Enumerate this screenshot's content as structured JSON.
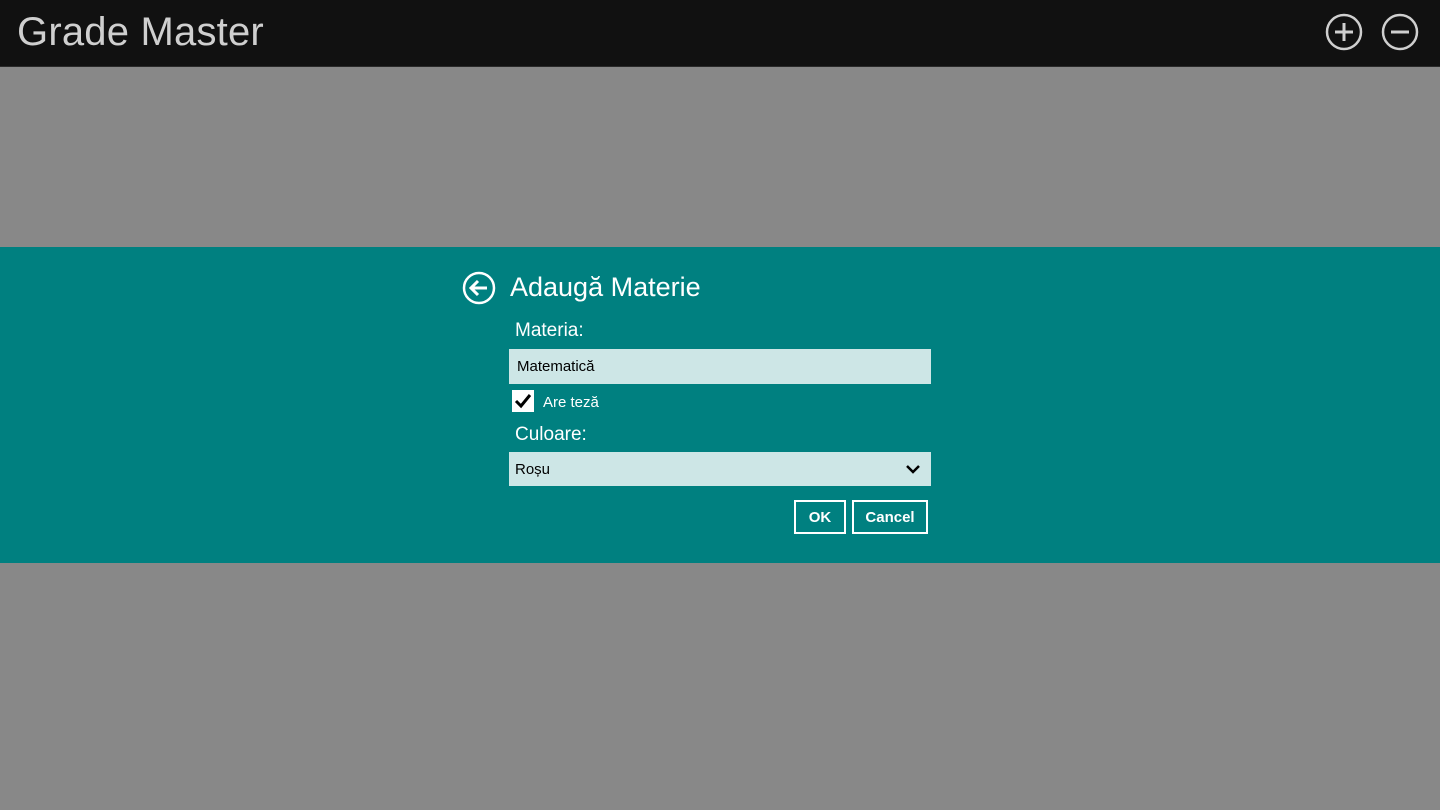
{
  "app": {
    "title": "Grade Master",
    "toolbar": {
      "add_icon": "plus-circle-icon",
      "remove_icon": "minus-circle-icon"
    }
  },
  "dialog": {
    "back_icon": "arrow-left-circle-icon",
    "title": "Adaugă Materie",
    "subject_label": "Materia:",
    "subject_value": "Matematică",
    "has_thesis_label": "Are teză",
    "has_thesis_checked": true,
    "color_label": "Culoare:",
    "color_value": "Roșu",
    "ok_label": "OK",
    "cancel_label": "Cancel"
  },
  "colors": {
    "titlebar": "#111111",
    "overlay": "#888888",
    "dialog_band": "#008080",
    "input_bg": "#cde6e6"
  }
}
